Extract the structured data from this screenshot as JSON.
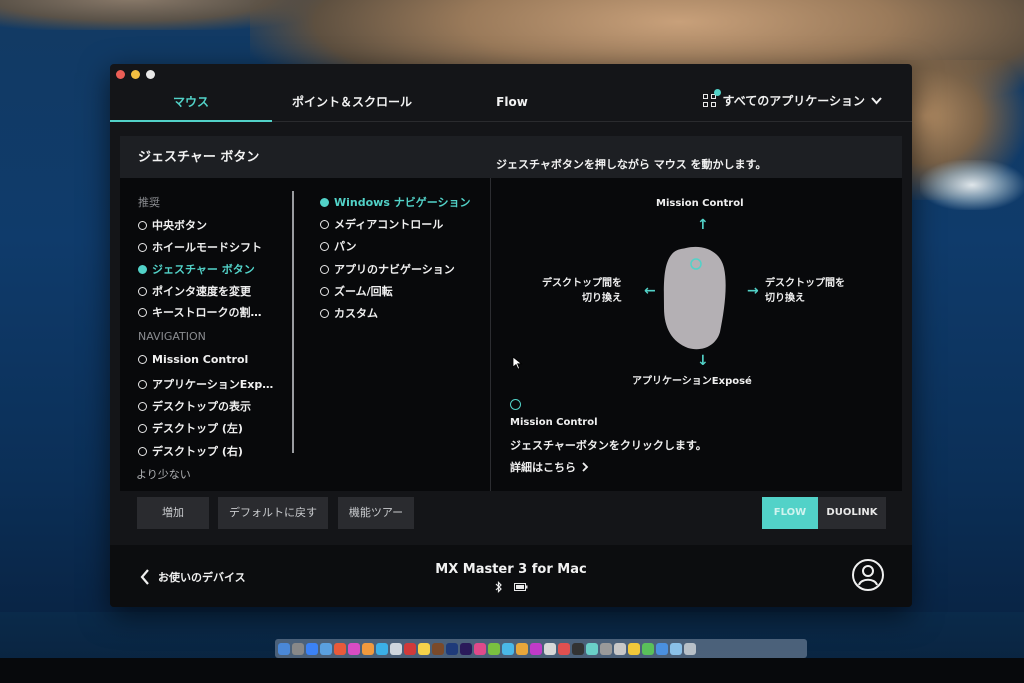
{
  "window": {
    "traffic_lights": [
      "close",
      "minimize",
      "zoom"
    ]
  },
  "tabs": [
    {
      "label": "マウス",
      "active": true
    },
    {
      "label": "ポイント＆スクロール",
      "active": false
    },
    {
      "label": "Flow",
      "active": false
    }
  ],
  "apps_selector": {
    "label": "すべてのアプリケーション",
    "icon": "grid-icon"
  },
  "panel": {
    "title": "ジェスチャー ボタン",
    "description": "ジェスチャボタンを押しながら マウス を動かします。"
  },
  "left_list": {
    "section1": "推奨",
    "items1": [
      {
        "label": "中央ボタン",
        "selected": false
      },
      {
        "label": "ホイールモードシフト",
        "selected": false
      },
      {
        "label": "ジェスチャー ボタン",
        "selected": true
      },
      {
        "label": "ポインタ速度を変更",
        "selected": false
      },
      {
        "label": "キーストロークの割…",
        "selected": false
      }
    ],
    "section2": "NAVIGATION",
    "items2": [
      {
        "label": "Mission Control"
      },
      {
        "label": "アプリケーションExp…"
      },
      {
        "label": "デスクトップの表示"
      },
      {
        "label": "デスクトップ (左)"
      },
      {
        "label": "デスクトップ (右)"
      }
    ],
    "less_link": "より少ない"
  },
  "middle_list": [
    {
      "label": "Windows ナビゲーション",
      "selected": true
    },
    {
      "label": "メディアコントロール",
      "selected": false
    },
    {
      "label": "パン",
      "selected": false
    },
    {
      "label": "アプリのナビゲーション",
      "selected": false
    },
    {
      "label": "ズーム/回転",
      "selected": false
    },
    {
      "label": "カスタム",
      "selected": false
    }
  ],
  "diagram": {
    "up": "Mission Control",
    "left_line1": "デスクトップ間を",
    "left_line2": "切り換え",
    "right_line1": "デスクトップ間を",
    "right_line2": "切り換え",
    "down": "アプリケーションExposé"
  },
  "click_action": {
    "title": "Mission Control",
    "desc": "ジェスチャーボタンをクリックします。",
    "more": "詳細はこちら"
  },
  "buttons": {
    "add": "増加",
    "restore": "デフォルトに戻す",
    "tour": "機能ツアー",
    "toggle_on": "FLOW",
    "toggle_off": "DUOLINK"
  },
  "footer": {
    "back_label": "お使いのデバイス",
    "device_name": "MX Master 3 for Mac"
  },
  "colors": {
    "accent": "#52d2c8",
    "window_bg": "#141518",
    "panel_bg": "#08090b"
  }
}
